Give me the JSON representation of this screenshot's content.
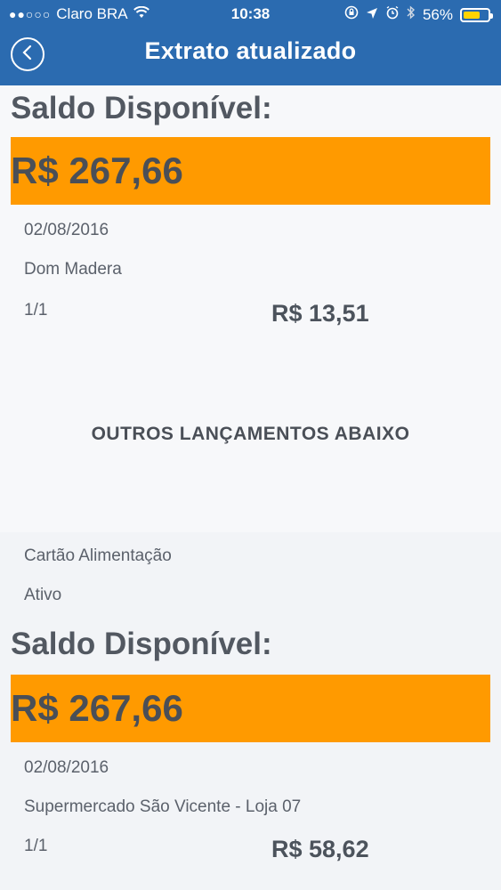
{
  "status": {
    "carrier": "Claro BRA",
    "time": "10:38",
    "battery_percent": "56%",
    "signal_dots": "●●○○○"
  },
  "nav": {
    "title": "Extrato atualizado"
  },
  "section1": {
    "saldo_label": "Saldo Disponível:",
    "saldo_value": "R$ 267,66",
    "date": "02/08/2016",
    "merchant": "Dom Madera",
    "installments": "1/1",
    "amount": "R$ 13,51"
  },
  "more_notice": "OUTROS LANÇAMENTOS ABAIXO",
  "section2": {
    "card_type": "Cartão Alimentação",
    "card_status": "Ativo",
    "saldo_label": "Saldo Disponível:",
    "saldo_value": "R$ 267,66",
    "date": "02/08/2016",
    "merchant": "Supermercado São Vicente - Loja 07",
    "installments": "1/1",
    "amount": "R$ 58,62"
  },
  "colors": {
    "header": "#2b6bb0",
    "saldo_box": "#ff9a00"
  }
}
